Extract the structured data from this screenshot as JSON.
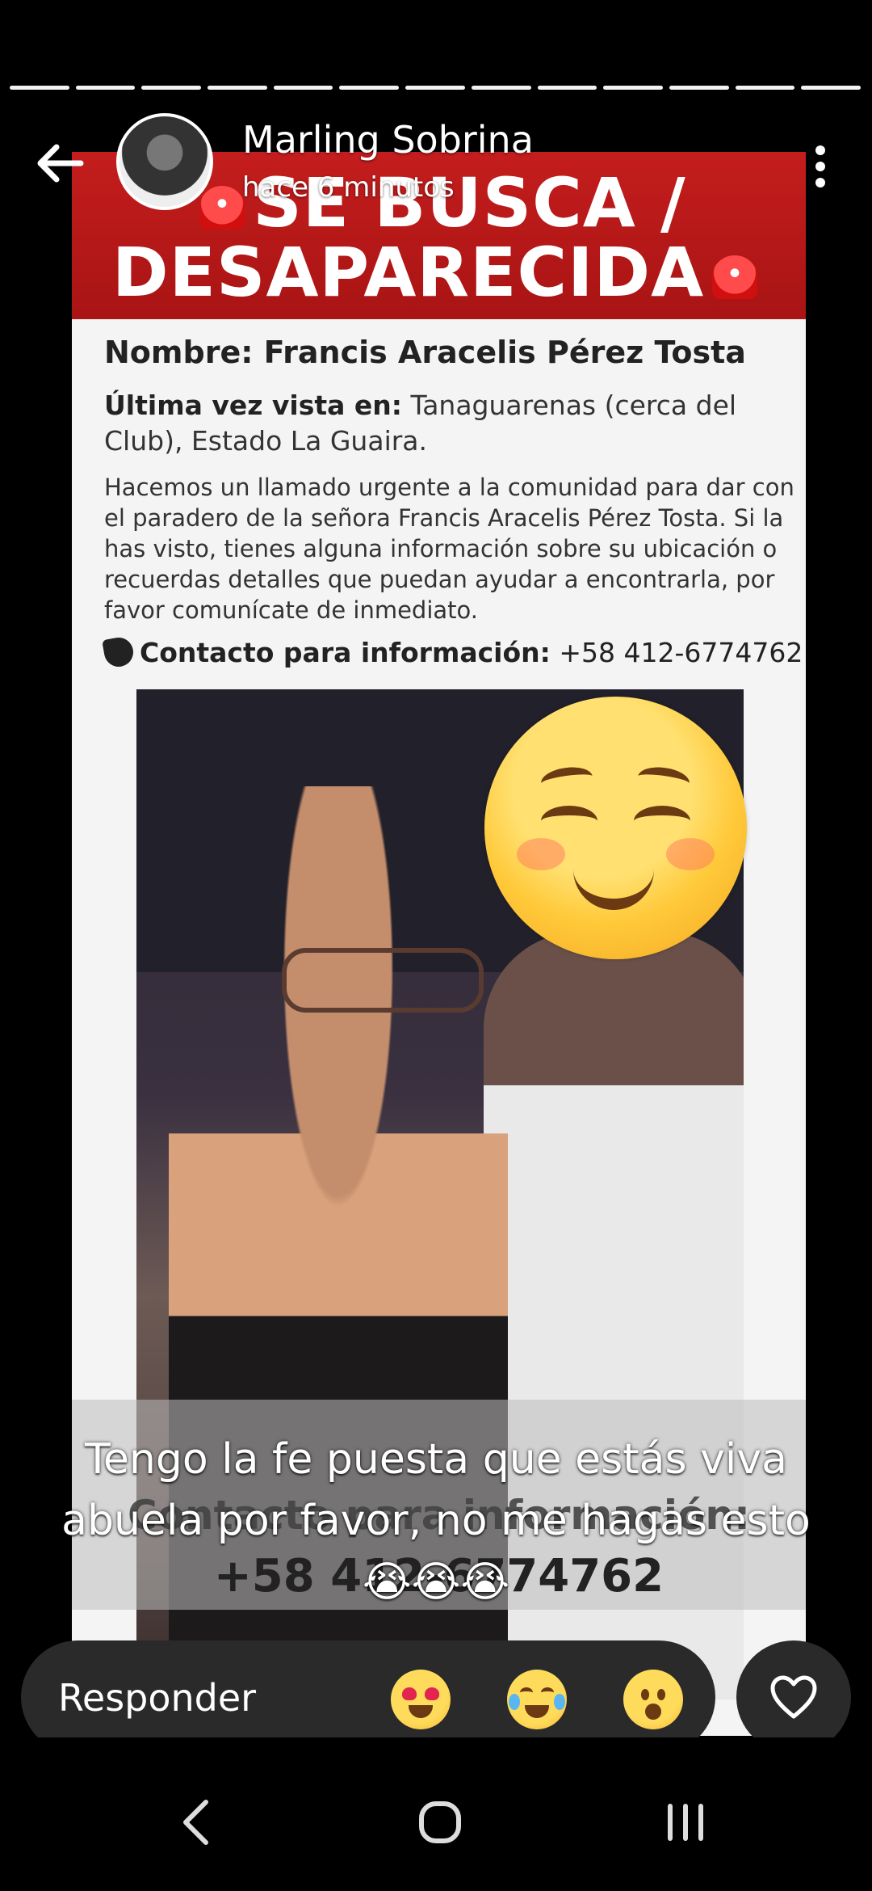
{
  "story": {
    "progress_segments": 13,
    "user_name": "Marling Sobrina",
    "timestamp": "hace 6 minutos",
    "caption": "Tengo la fe puesta que estás viva abuela por favor, no me hagas esto 😭😭😭"
  },
  "poster": {
    "title_line1": "SE BUSCA /",
    "title_line2": "DESAPARECIDA",
    "name_line": "Nombre: Francis Aracelis Pérez Tosta",
    "seen_label": "Última vez vista en:",
    "seen_value": "Tanaguarenas (cerca del Club), Estado La Guaira.",
    "body": "Hacemos un llamado urgente a la comunidad para dar con el paradero de la señora Francis Aracelis Pérez Tosta. Si la has visto, tienes alguna información sobre su ubicación o recuerdas detalles que puedan ayudar a encontrarla, por favor comunícate de inmediato.",
    "contact_label": "Contacto para información:",
    "contact_phone": "+58 412-6774762",
    "bottom_contact_label": "Contacto para información:",
    "bottom_phone": "+58 412-6774762"
  },
  "reply": {
    "placeholder": "Responder",
    "reactions": [
      "heart-eyes",
      "laughing-tears",
      "surprised"
    ]
  },
  "colors": {
    "banner_red": "#c41d1d",
    "bar_dark": "#2a2a2a"
  }
}
